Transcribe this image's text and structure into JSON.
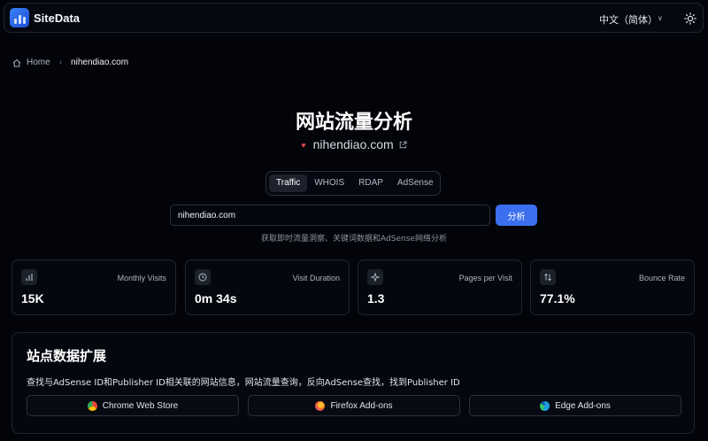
{
  "header": {
    "brand": "SiteData",
    "language": "中文（简体）"
  },
  "breadcrumb": {
    "home": "Home",
    "current": "nihendiao.com"
  },
  "hero": {
    "title": "网站流量分析",
    "site": "nihendiao.com"
  },
  "tabs": [
    "Traffic",
    "WHOIS",
    "RDAP",
    "AdSense"
  ],
  "search": {
    "value": "nihendiao.com",
    "button": "分析",
    "hint": "获取即时流量洞察、关键词数据和AdSense网络分析"
  },
  "stats": [
    {
      "label": "Monthly Visits",
      "value": "15K",
      "icon": "bar-chart-icon"
    },
    {
      "label": "Visit Duration",
      "value": "0m 34s",
      "icon": "clock-icon"
    },
    {
      "label": "Pages per Visit",
      "value": "1.3",
      "icon": "sparkle-icon"
    },
    {
      "label": "Bounce Rate",
      "value": "77.1%",
      "icon": "arrows-updown-icon"
    }
  ],
  "extensions": {
    "title": "站点数据扩展",
    "description": "查找与AdSense ID和Publisher ID相关联的网站信息，网站流量查询，反向AdSense查找，找到Publisher ID",
    "stores": [
      {
        "label": "Chrome Web Store",
        "icon": "chrome-icon"
      },
      {
        "label": "Firefox Add-ons",
        "icon": "firefox-icon"
      },
      {
        "label": "Edge Add-ons",
        "icon": "edge-icon"
      }
    ]
  },
  "colors": {
    "background": "#020409",
    "accent": "#3b6ff0",
    "card_border": "#1f2531"
  }
}
